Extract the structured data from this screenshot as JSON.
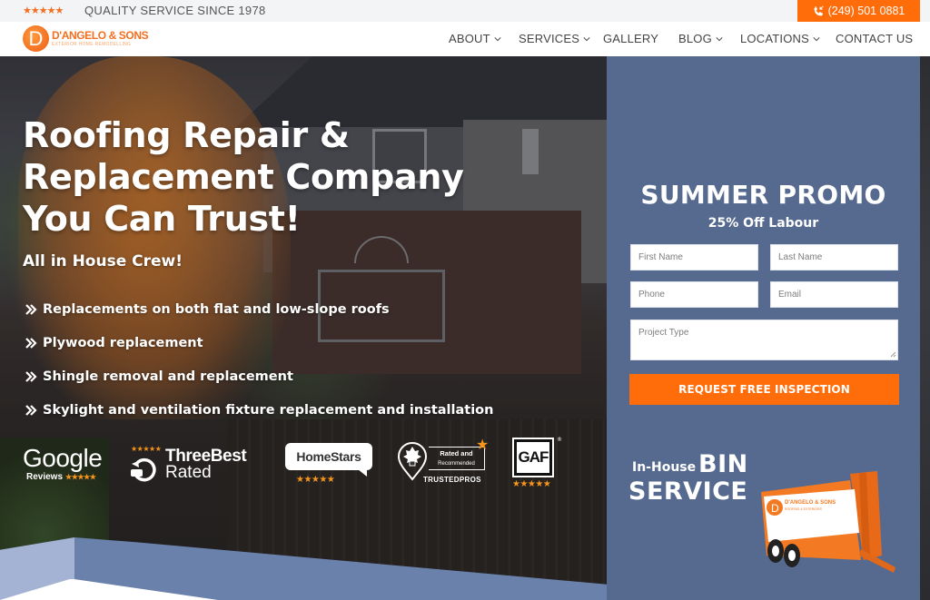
{
  "topbar": {
    "rating_stars": "★★★★★",
    "tagline": "QUALITY SERVICE SINCE 1978",
    "phone": "(249) 501 0881",
    "phone_icon": "phone-icon"
  },
  "brand": {
    "logo_letter": "D",
    "name": "D'ANGELO & SONS",
    "subtitle": "EXTERIOR HOME REMODELLING"
  },
  "nav": {
    "items": [
      {
        "label": "ABOUT",
        "dropdown": true
      },
      {
        "label": "SERVICES",
        "dropdown": true
      },
      {
        "label": "GALLERY",
        "dropdown": false
      },
      {
        "label": "BLOG",
        "dropdown": true
      },
      {
        "label": "LOCATIONS",
        "dropdown": true
      },
      {
        "label": "CONTACT US",
        "dropdown": false
      }
    ]
  },
  "hero": {
    "title_lines": [
      "Roofing Repair &",
      "Replacement Company",
      "You Can Trust!"
    ],
    "subtitle": "All in House Crew!",
    "features": [
      "Replacements on both flat and low-slope roofs",
      "Plywood replacement",
      "Shingle removal and replacement",
      "Skylight and ventilation fixture replacement and installation"
    ],
    "feature_icon": "double-chevron-right-icon"
  },
  "badges": {
    "google": {
      "name": "Google",
      "label": "Reviews",
      "stars": "★★★★★"
    },
    "threebest": {
      "line1": "ThreeBest",
      "line2": "Rated",
      "stars": "★★★★★"
    },
    "homestars": {
      "name": "HomeStars",
      "stars": "★★★★★"
    },
    "trustedpros": {
      "line1": "Rated and",
      "line2": "Recommended",
      "name": "TRUSTEDPROS",
      "star": "★"
    },
    "gaf": {
      "name": "GAF",
      "reg": "®",
      "stars": "★★★★★"
    }
  },
  "promo": {
    "title": "SUMMER PROMO",
    "subtitle": "25% Off Labour",
    "fields": {
      "first_name": {
        "placeholder": "First Name",
        "value": ""
      },
      "last_name": {
        "placeholder": "Last Name",
        "value": ""
      },
      "phone": {
        "placeholder": "Phone",
        "value": ""
      },
      "email": {
        "placeholder": "Email",
        "value": ""
      },
      "project_type": {
        "placeholder": "Project Type",
        "value": ""
      }
    },
    "submit_label": "REQUEST FREE INSPECTION",
    "bin": {
      "prefix": "In-House",
      "big": "BIN",
      "second": "SERVICE"
    },
    "trailer_text": "D'ANGELO & SONS",
    "trailer_sub": "ROOFING & EXTERIORS"
  },
  "colors": {
    "accent": "#ff6d0a",
    "brand_orange": "#f36f21",
    "panel_blue": "#566a8f",
    "star": "#f7941d"
  }
}
